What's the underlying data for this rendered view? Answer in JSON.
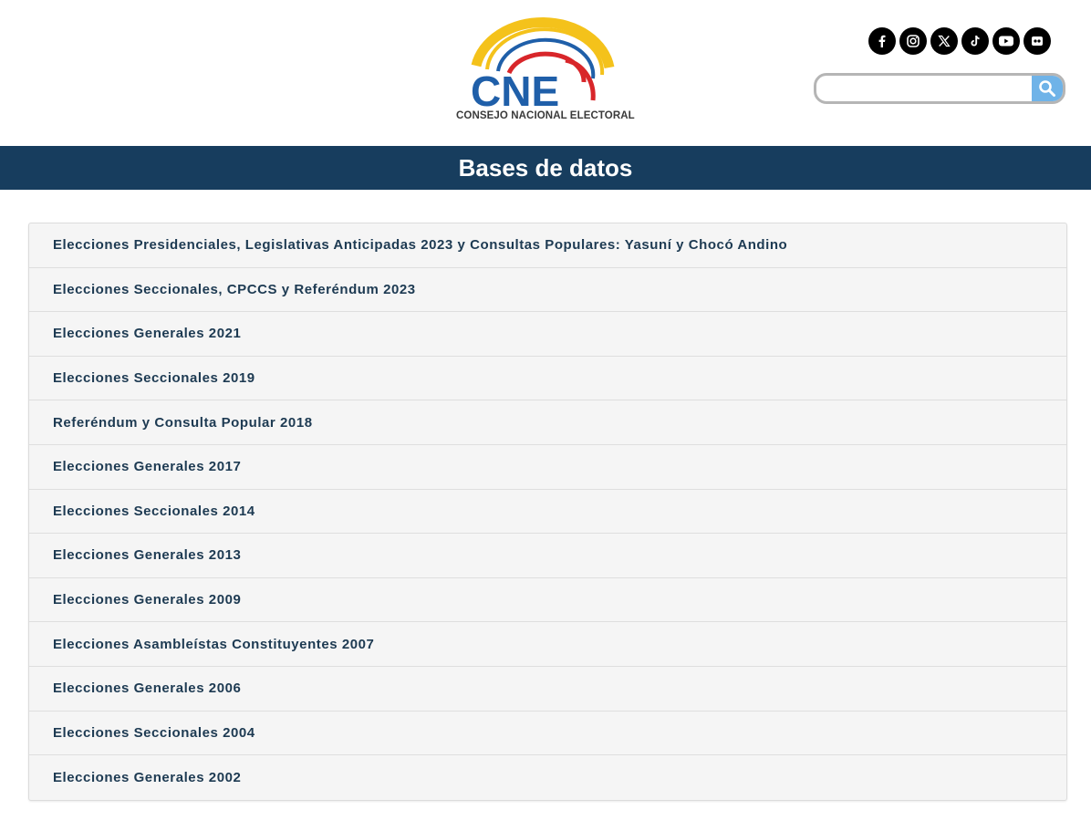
{
  "header": {
    "logo_caption": "CONSEJO NACIONAL ELECTORAL",
    "logo_text": "CNE",
    "socials": [
      {
        "name": "facebook-icon"
      },
      {
        "name": "instagram-icon"
      },
      {
        "name": "x-icon"
      },
      {
        "name": "tiktok-icon"
      },
      {
        "name": "youtube-icon"
      },
      {
        "name": "flickr-icon"
      }
    ],
    "search": {
      "placeholder": "",
      "value": ""
    }
  },
  "page": {
    "title": "Bases de datos"
  },
  "databases": [
    {
      "label": "Elecciones Presidenciales, Legislativas Anticipadas 2023 y Consultas Populares: Yasuní y Chocó Andino"
    },
    {
      "label": "Elecciones Seccionales, CPCCS y Referéndum 2023"
    },
    {
      "label": "Elecciones Generales 2021"
    },
    {
      "label": "Elecciones Seccionales 2019"
    },
    {
      "label": "Referéndum y Consulta Popular 2018"
    },
    {
      "label": "Elecciones Generales 2017"
    },
    {
      "label": "Elecciones Seccionales 2014"
    },
    {
      "label": "Elecciones Generales 2013"
    },
    {
      "label": "Elecciones Generales 2009"
    },
    {
      "label": "Elecciones Asambleístas Constituyentes 2007"
    },
    {
      "label": "Elecciones Generales 2006"
    },
    {
      "label": "Elecciones Seccionales 2004"
    },
    {
      "label": "Elecciones Generales 2002"
    }
  ],
  "colors": {
    "title_bar": "#173d5e",
    "item_text": "#1d3a52",
    "list_bg": "#f5f5f5",
    "search_button": "#6fb3e8",
    "logo_blue": "#1f5fa9",
    "logo_red": "#d8262a",
    "logo_yellow": "#f4c21b"
  }
}
